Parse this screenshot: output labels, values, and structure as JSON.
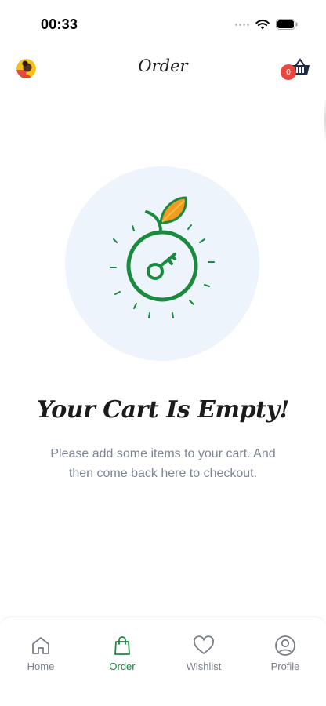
{
  "status_bar": {
    "time": "00:33"
  },
  "header": {
    "title": "Order",
    "cart_count": "0"
  },
  "empty_state": {
    "title": "Your Cart Is Empty!",
    "description": "Please add some items to your cart. And then come back here to checkout."
  },
  "bottom_nav": {
    "items": [
      {
        "label": "Home",
        "icon": "home-icon"
      },
      {
        "label": "Order",
        "icon": "shopping-bag-icon",
        "active": true
      },
      {
        "label": "Wishlist",
        "icon": "heart-icon"
      },
      {
        "label": "Profile",
        "icon": "user-circle-icon"
      }
    ]
  },
  "colors": {
    "accent": "#1a8a3e",
    "badge": "#e8483f",
    "muted": "#7d8594",
    "illustration_bg": "#eef4fc"
  }
}
